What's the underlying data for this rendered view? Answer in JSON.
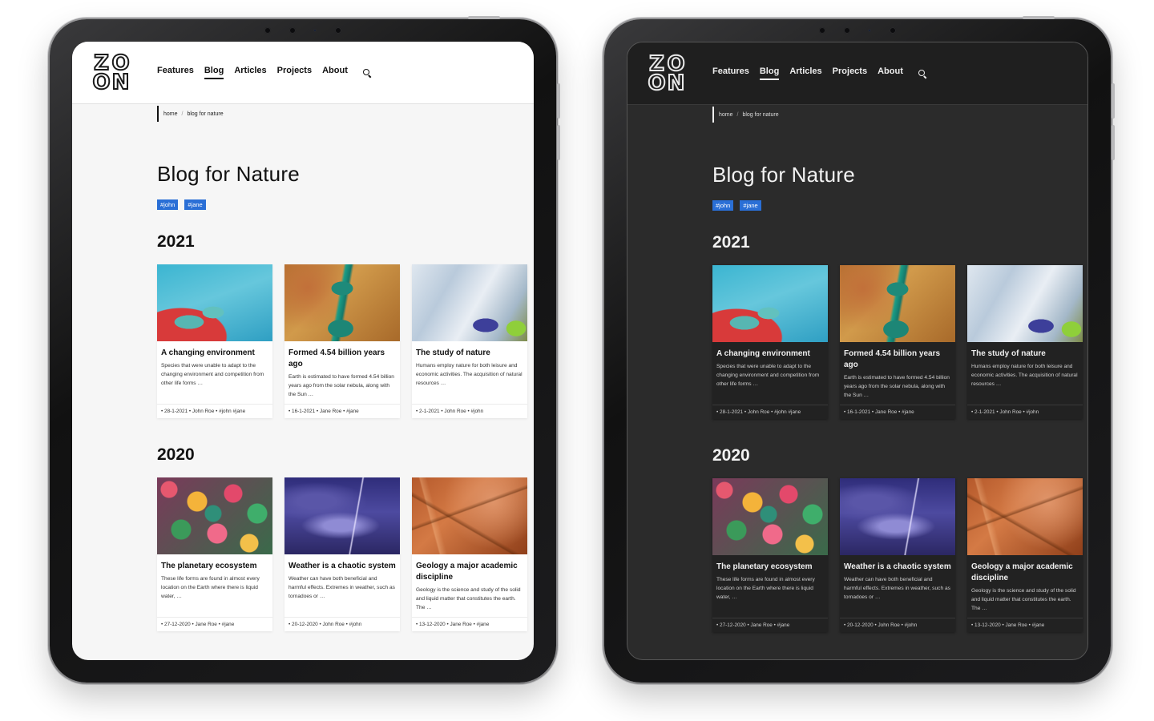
{
  "site": {
    "logo_glyphs": [
      "Z",
      "O",
      "O",
      "N"
    ],
    "nav": [
      "Features",
      "Blog",
      "Articles",
      "Projects",
      "About"
    ],
    "nav_active": "Blog",
    "search_icon": "search-icon"
  },
  "breadcrumb": {
    "home": "home",
    "separator": "/",
    "current": "blog for nature"
  },
  "page": {
    "title": "Blog for Nature",
    "tags": [
      "#john",
      "#jane"
    ]
  },
  "colors": {
    "tag_bg": "#2a6fd6",
    "light_bg": "#f6f6f6",
    "dark_bg": "#2b2b2b"
  },
  "sections": [
    {
      "year": "2021",
      "posts": [
        {
          "title": "A changing environment",
          "excerpt": "Species that were unable to adapt to the changing environment and competition from other life forms …",
          "meta": "• 28-1-2021  • John Roe  • #john  #jane",
          "image": "coast"
        },
        {
          "title": "Formed 4.54 billion years ago",
          "excerpt": "Earth is estimated to have formed 4.54 billion years ago from the solar nebula, along with the Sun …",
          "meta": "• 16-1-2021  • Jane Roe  • #jane",
          "image": "river"
        },
        {
          "title": "The study of nature",
          "excerpt": "Humans employ nature for both leisure and economic activities. The acquisition of natural resources …",
          "meta": "• 2-1-2021  • John Roe  • #john",
          "image": "delta"
        }
      ]
    },
    {
      "year": "2020",
      "posts": [
        {
          "title": "The planetary ecosystem",
          "excerpt": "These life forms are found in almost every location on the Earth where there is liquid water, …",
          "meta": "• 27-12-2020  • Jane Roe  • #jane",
          "image": "forest"
        },
        {
          "title": "Weather is a chaotic system",
          "excerpt": "Weather can have both beneficial and harmful effects. Extremes in weather, such as tornadoes or …",
          "meta": "• 20-12-2020  • John Roe  • #john",
          "image": "storm"
        },
        {
          "title": "Geology a major academic discipline",
          "excerpt": "Geology is the science and study of the solid and liquid matter that constitutes the earth. The …",
          "meta": "• 13-12-2020  • Jane Roe  • #jane",
          "image": "rock"
        }
      ]
    }
  ]
}
